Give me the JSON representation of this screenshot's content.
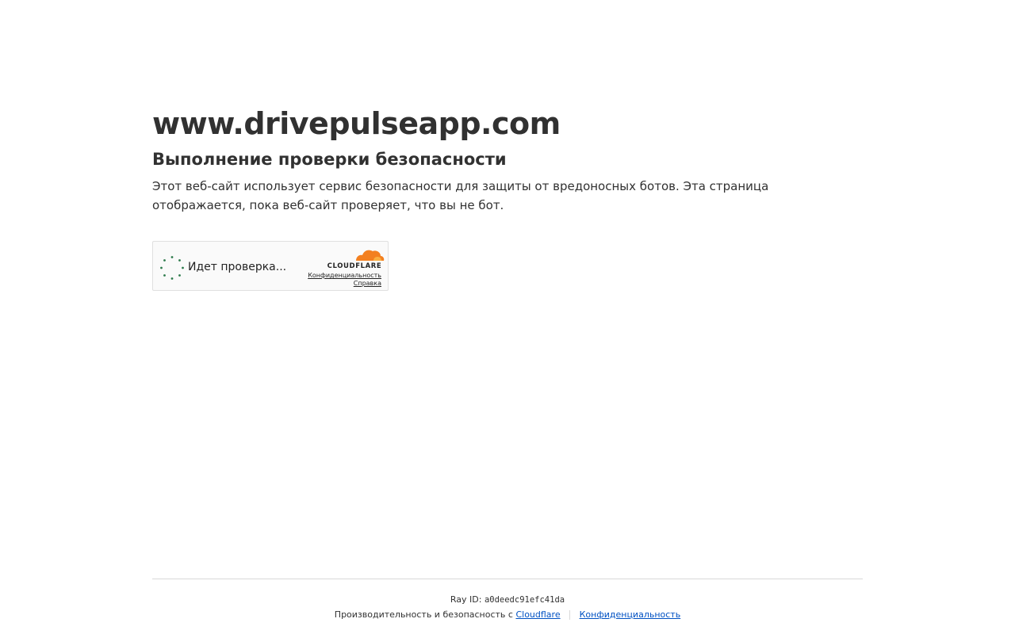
{
  "page": {
    "site_name": "www.drivepulseapp.com",
    "heading": "Выполнение проверки безопасности",
    "description": "Этот веб-сайт использует сервис безопасности для защиты от вредоносных ботов. Эта страница отображается, пока веб-сайт проверяет, что вы не бот."
  },
  "widget": {
    "status": "Идет проверка...",
    "brand": "CLOUDFLARE",
    "privacy_link": "Конфиденциальность",
    "help_link": "Справка",
    "spinner_color": "#2c7a4b",
    "brand_color": "#f38020"
  },
  "footer": {
    "ray_label": "Ray ID:",
    "ray_id": "a0deedc91efc41da",
    "perf_text": "Производительность и безопасность с",
    "cloudflare_link": "Cloudflare",
    "privacy_link": "Конфиденциальность",
    "link_color": "#0051c3"
  }
}
